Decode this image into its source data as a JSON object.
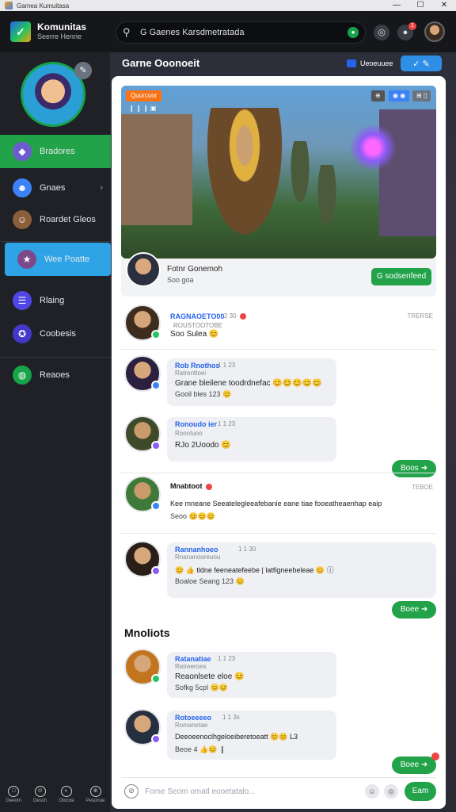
{
  "window": {
    "title": "Gamea Kumuitasa",
    "controls": [
      "—",
      "☐",
      "✕"
    ]
  },
  "header": {
    "brand_title": "Komunitas",
    "brand_sub": "Seerre Henrie",
    "search_text": "G  Gaenes Karsdmetratada",
    "notif_count": "1"
  },
  "sidebar": {
    "items": [
      {
        "label": "Bradores",
        "icon": "controller-icon"
      },
      {
        "label": "Gnaes",
        "icon": "discord-icon"
      },
      {
        "label": "Roardet Gleos",
        "icon": "user-icon"
      },
      {
        "label": "Wee Poatte",
        "icon": "star-icon"
      },
      {
        "label": "Rlaing",
        "icon": "list-icon"
      },
      {
        "label": "Coobesis",
        "icon": "group-icon"
      },
      {
        "label": "Reaoes",
        "icon": "globe-icon"
      }
    ],
    "bottom": [
      {
        "label": "Deeom",
        "icon": "□"
      },
      {
        "label": "Dessh",
        "icon": "⊙"
      },
      {
        "label": "Otocde",
        "icon": "◐"
      },
      {
        "label": "Pesonue",
        "icon": "⊕"
      }
    ]
  },
  "page": {
    "title": "Garne Ooonoeit",
    "action1": "Ueoeuuee",
    "action2": "✓  ✎"
  },
  "hero": {
    "tag": "Quurcoor",
    "tag2": "❙ ❙ ❙  ▣",
    "tags_right": [
      "⊕",
      "◉ ◉",
      "⊞ ▯"
    ],
    "author": "Fotnr Gonemoh",
    "author_sub": "Soo goa",
    "follow": "G sodsenfeed"
  },
  "comments": [
    {
      "name": "RAGNAOETO00",
      "meta": "2 30",
      "sub": "ROUSTOOTOBE",
      "body": "Soo Sulea 😊",
      "time": "TRERSE"
    },
    {
      "name": "Rob Rnothos",
      "meta": "1 1 23",
      "sub": "Ratrenttoei",
      "body": "Grane bleilene toodrdnefac 😊😊😊😊😊",
      "body2": "Gooil bles 123 😊"
    },
    {
      "name": "Ronoudo ier",
      "meta": "1 1 23",
      "sub": "Ronotuoo",
      "body": "RJo 2Uoodo 😊",
      "reply": "Boos  ➜"
    },
    {
      "name": "Mnabtoot",
      "time": "TEBOE",
      "body": "Kee mneane Seeatelegleeafebanie eane tiae fooeatheaenhap eaip",
      "body2": "Seoo 😊😊😊"
    },
    {
      "name": "Rannanhoeo",
      "meta": "1 1 30",
      "sub": "Rnananooreuou",
      "body": "😊 👍 tldne feeneatefeebe | latfigneebeleae 😊 ⓘ",
      "body2": "Boaloe Seang 123 😊",
      "reply": "Boee  ➜"
    }
  ],
  "section": {
    "title": "Mnoliots"
  },
  "comments2": [
    {
      "name": "Ratanatiae",
      "meta": "1 1 23",
      "sub": "Ratreeroes",
      "body": "Reaonlsete eloe 😊",
      "body2": "Sofkg 5cpl 😊😊"
    },
    {
      "name": "Rotoeeeeo",
      "meta": "1 1 3s",
      "sub": "Romanetae",
      "body": "Deeoeenoclhgeloeiberetoeatt 😊😊 L3",
      "body2": "Beoe 4 👍😊 ❙",
      "reply": "Boee  ➜"
    }
  ],
  "composer": {
    "placeholder": "Fome Seom omatl eooetatalo...",
    "send": "Eam"
  },
  "colors": {
    "accent_green": "#22a34a",
    "accent_blue": "#2ea4e6",
    "link": "#2563eb"
  }
}
